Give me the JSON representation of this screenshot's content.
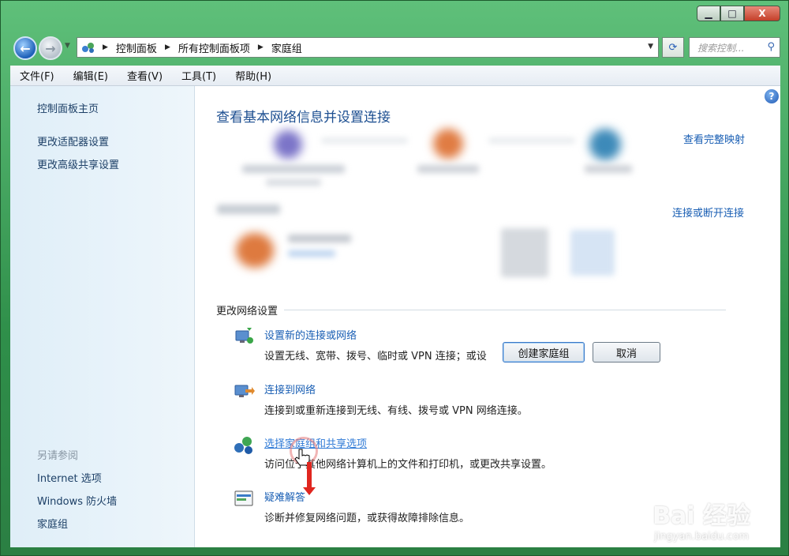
{
  "window": {
    "minimize_icon": "minimize-icon",
    "maximize_icon": "maximize-icon",
    "close_label": "X"
  },
  "address": {
    "crumbs": [
      "控制面板",
      "所有控制面板项",
      "家庭组"
    ],
    "search_placeholder": "搜索控制...",
    "back_icon": "back-arrow-icon",
    "forward_icon": "forward-arrow-icon",
    "refresh_icon": "refresh-icon",
    "search_icon": "search-icon"
  },
  "menu": {
    "items": [
      "文件(F)",
      "编辑(E)",
      "查看(V)",
      "工具(T)",
      "帮助(H)"
    ]
  },
  "sidebar": {
    "home": "控制面板主页",
    "links": [
      "更改适配器设置",
      "更改高级共享设置"
    ],
    "see_also_heading": "另请参阅",
    "see_also": [
      "Internet 选项",
      "Windows 防火墙",
      "家庭组"
    ]
  },
  "main": {
    "title": "查看基本网络信息并设置连接",
    "view_full_map": "查看完整映射",
    "connect_disconnect": "连接或断开连接",
    "section_heading": "更改网络设置",
    "tasks": [
      {
        "link": "设置新的连接或网络",
        "desc": "设置无线、宽带、拨号、临时或 VPN 连接；或设",
        "icon": "new-connection-icon"
      },
      {
        "link": "连接到网络",
        "desc": "连接到或重新连接到无线、有线、拨号或 VPN 网络连接。",
        "icon": "connect-network-icon"
      },
      {
        "link": "选择家庭组和共享选项",
        "desc": "访问位于其他网络计算机上的文件和打印机，或更改共享设置。",
        "icon": "homegroup-icon"
      },
      {
        "link": "疑难解答",
        "desc": "诊断并修复网络问题，或获得故障排除信息。",
        "icon": "troubleshoot-icon"
      }
    ],
    "dialog_buttons": {
      "create": "创建家庭组",
      "cancel": "取消"
    }
  },
  "watermark": {
    "main": "Bai 经验",
    "sub": "jingyan.baidu.com"
  }
}
